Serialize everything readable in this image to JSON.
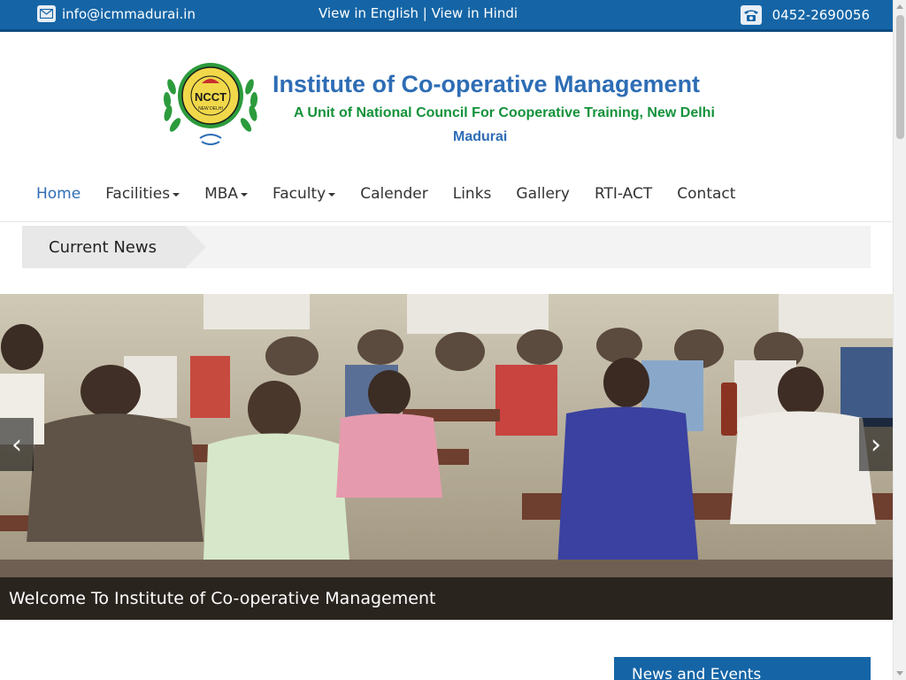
{
  "topbar": {
    "email": "info@icmmadurai.in",
    "lang_english": "View in English",
    "lang_sep": "|",
    "lang_hindi": "View in Hindi",
    "phone": "0452-2690056",
    "icons": {
      "email": "envelope-icon",
      "phone": "telephone-icon"
    }
  },
  "header": {
    "title": "Institute of Co-operative Management",
    "subtitle": "A Unit of National Council For Cooperative Training, New Delhi",
    "city": "Madurai",
    "logo": {
      "abbr": "NCCT",
      "place": "NEW DELHI"
    }
  },
  "nav": {
    "items": [
      {
        "label": "Home",
        "active": true,
        "dropdown": false
      },
      {
        "label": "Facilities",
        "active": false,
        "dropdown": true
      },
      {
        "label": "MBA",
        "active": false,
        "dropdown": true
      },
      {
        "label": "Faculty",
        "active": false,
        "dropdown": true
      },
      {
        "label": "Calender",
        "active": false,
        "dropdown": false
      },
      {
        "label": "Links",
        "active": false,
        "dropdown": false
      },
      {
        "label": "Gallery",
        "active": false,
        "dropdown": false
      },
      {
        "label": "RTI-ACT",
        "active": false,
        "dropdown": false
      },
      {
        "label": "Contact",
        "active": false,
        "dropdown": false
      }
    ]
  },
  "current_news": {
    "label": "Current News"
  },
  "slider": {
    "caption": "Welcome To Institute of Co-operative Management",
    "prev_icon": "‹",
    "next_icon": "›"
  },
  "sidebar": {
    "news_events_title": "News and Events"
  },
  "colors": {
    "primary": "#1565a6",
    "title_blue": "#2e6db5",
    "subtitle_green": "#13923a",
    "nav_active": "#2e6db5"
  }
}
